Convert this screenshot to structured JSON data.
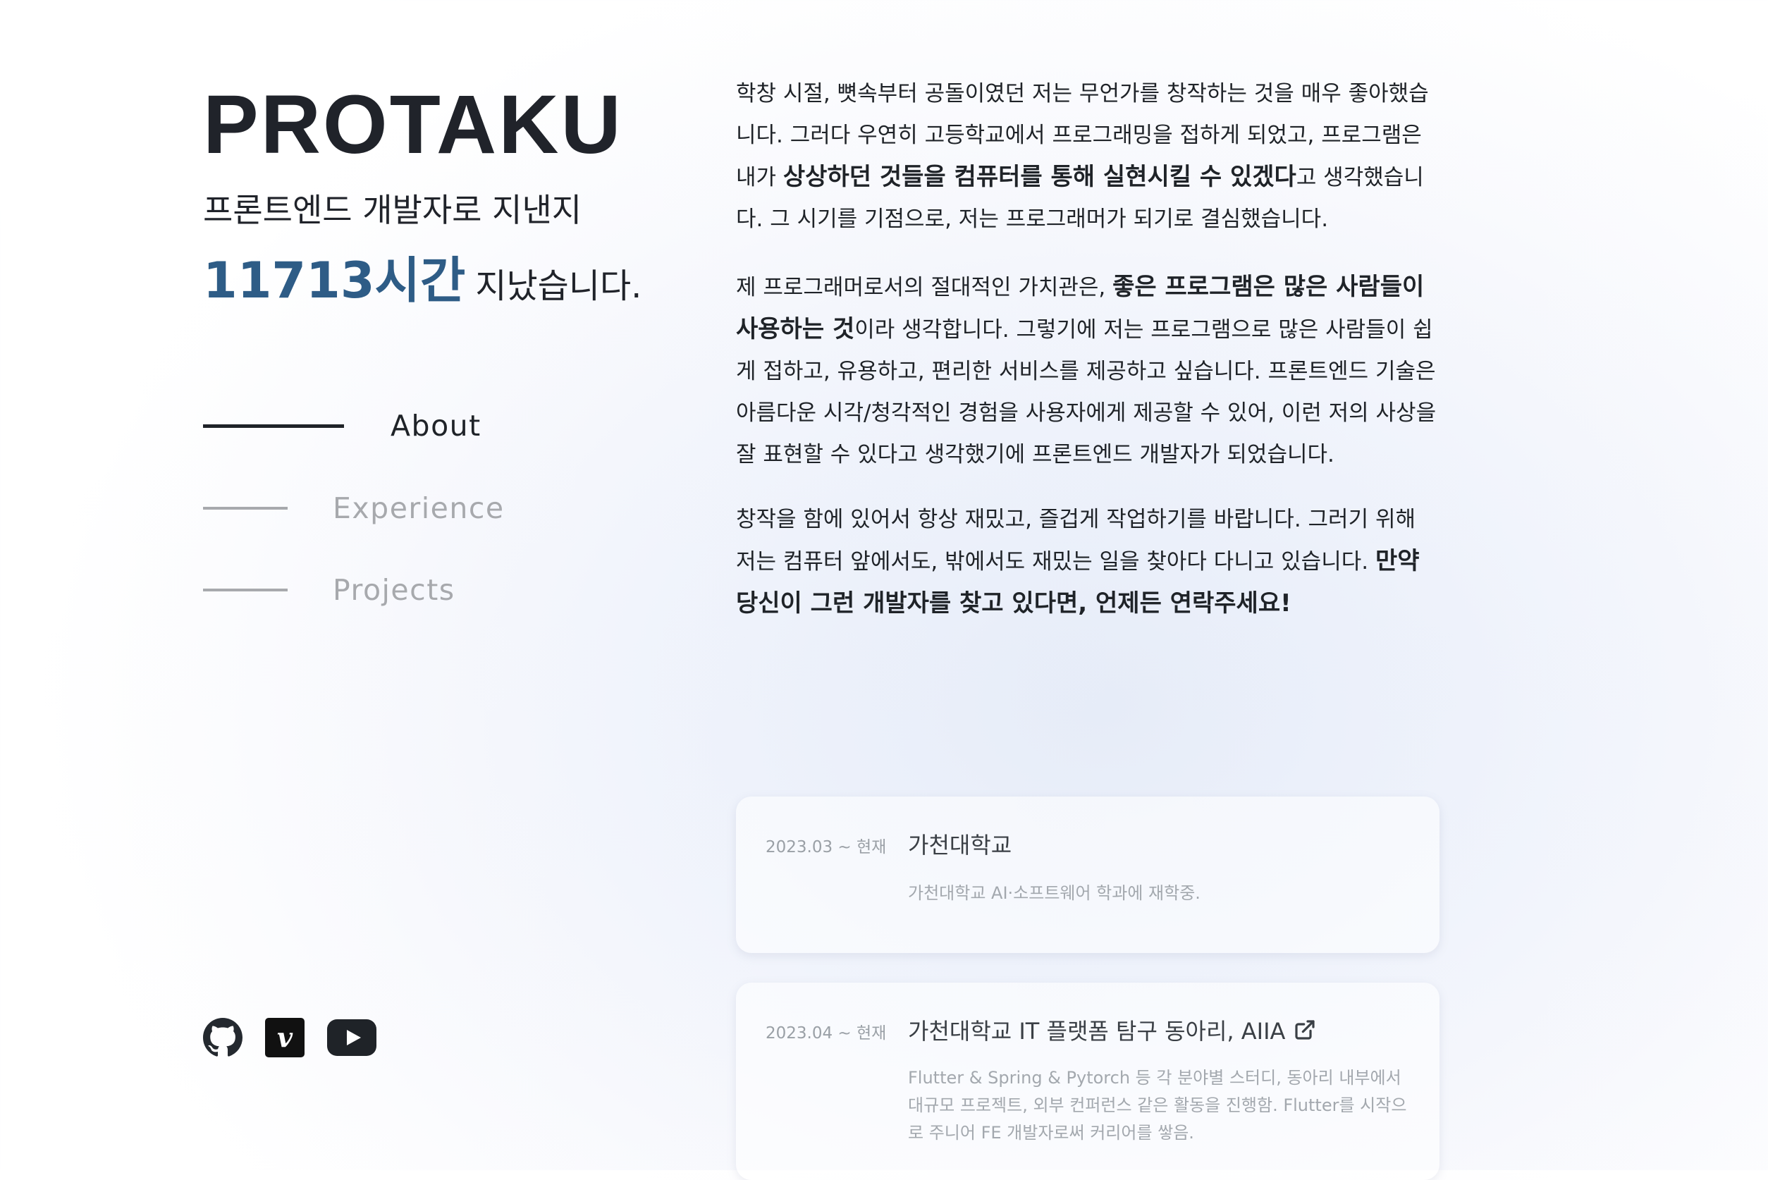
{
  "brand": "PROTAKU",
  "subtitle": "프론트엔드 개발자로 지낸지",
  "hours": {
    "value": "11713시간",
    "suffix": "지났습니다."
  },
  "nav": {
    "items": [
      {
        "label": "About",
        "active": true
      },
      {
        "label": "Experience",
        "active": false
      },
      {
        "label": "Projects",
        "active": false
      }
    ]
  },
  "socials": [
    {
      "icon": "github-icon"
    },
    {
      "icon": "vimeo-icon"
    },
    {
      "icon": "youtube-icon"
    }
  ],
  "about": {
    "p1": {
      "a": "학창 시절, 뼛속부터 공돌이였던 저는 무언가를 창작하는 것을 매우 좋아했습니다. 그러다 우연히 고등학교에서 프로그래밍을 접하게 되었고, 프로그램은 내가 ",
      "bold": "상상하던 것들을 컴퓨터를 통해 실현시킬 수 있겠다",
      "b": "고 생각했습니다. 그 시기를 기점으로, 저는 프로그래머가 되기로 결심했습니다."
    },
    "p2": {
      "a": "제 프로그래머로서의 절대적인 가치관은, ",
      "bold": "좋은 프로그램은 많은 사람들이 사용하는 것",
      "b": "이라 생각합니다. 그렇기에 저는 프로그램으로 많은 사람들이 쉽게 접하고, 유용하고, 편리한 서비스를 제공하고 싶습니다. 프론트엔드 기술은 아름다운 시각/청각적인 경험을 사용자에게 제공할 수 있어, 이런 저의 사상을 잘 표현할 수 있다고 생각했기에 프론트엔드 개발자가 되었습니다."
    },
    "p3": {
      "a": "창작을 함에 있어서 항상 재밌고, 즐겁게 작업하기를 바랍니다. 그러기 위해 저는 컴퓨터 앞에서도, 밖에서도 재밌는 일을 찾아다 다니고 있습니다. ",
      "bold": "만약 당신이 그런 개발자를 찾고 있다면, 언제든 연락주세요!"
    }
  },
  "experience": [
    {
      "date": "2023.03 ~ 현재",
      "title": "가천대학교",
      "desc": "가천대학교 AI·소프트웨어 학과에 재학중.",
      "external": false
    },
    {
      "date": "2023.04 ~ 현재",
      "title": "가천대학교 IT 플랫폼 탐구 동아리, AIIA",
      "desc": "Flutter & Spring & Pytorch 등 각 분야별 스터디, 동아리 내부에서 대규모 프로젝트, 외부 컨퍼런스 같은 활동을 진행함. Flutter를 시작으로 주니어 FE 개발자로써 커리어를 쌓음.",
      "external": true,
      "icon": "external-link-icon"
    }
  ],
  "colors": {
    "accent": "#2e5c86",
    "text": "#1f2328",
    "muted": "#a7a9ad"
  }
}
